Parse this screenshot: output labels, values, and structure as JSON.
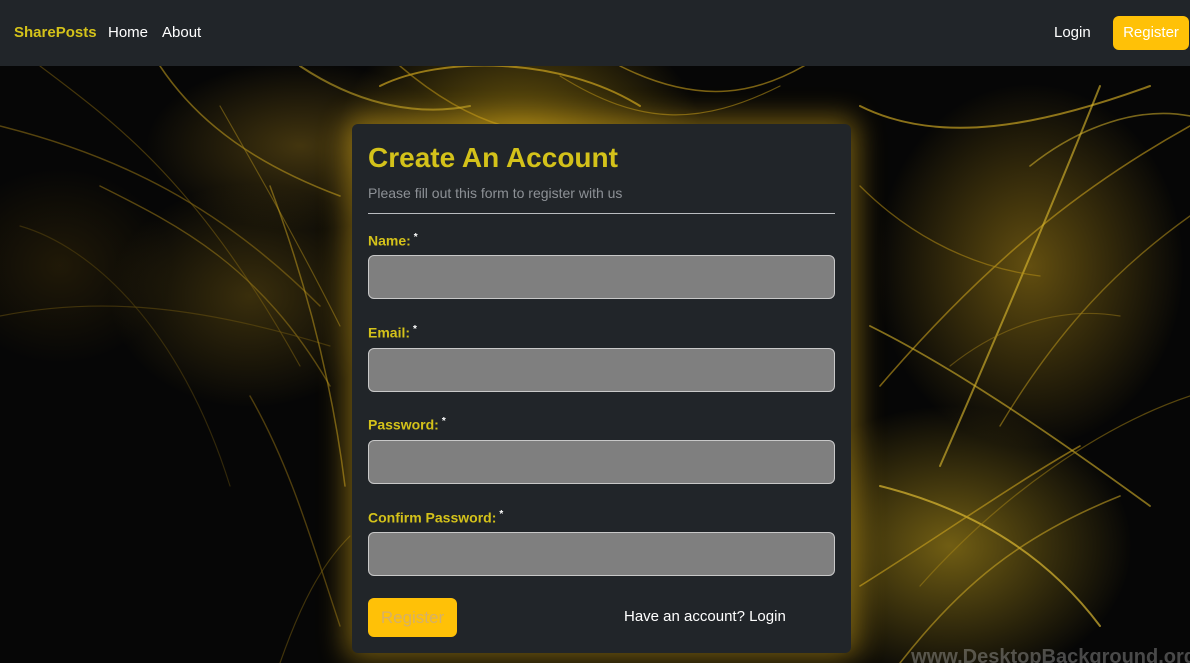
{
  "navbar": {
    "brand": "SharePosts",
    "links": [
      "Home",
      "About"
    ],
    "login": "Login",
    "register": "Register"
  },
  "form": {
    "title": "Create An Account",
    "subtitle": "Please fill out this form to register with us",
    "fields": [
      {
        "label": "Name:",
        "required_mark": "*",
        "value": ""
      },
      {
        "label": "Email:",
        "required_mark": "*",
        "value": ""
      },
      {
        "label": "Password:",
        "required_mark": "*",
        "value": ""
      },
      {
        "label": "Confirm Password:",
        "required_mark": "*",
        "value": ""
      }
    ],
    "submit_label": "Register",
    "login_link": "Have an account? Login"
  },
  "watermark": "www.DesktopBackground.org",
  "colors": {
    "accent": "#ffc107",
    "brand_text": "#d4c21a",
    "navbar_bg": "#212529",
    "card_bg": "#212529",
    "input_bg": "#7f7f7f"
  }
}
